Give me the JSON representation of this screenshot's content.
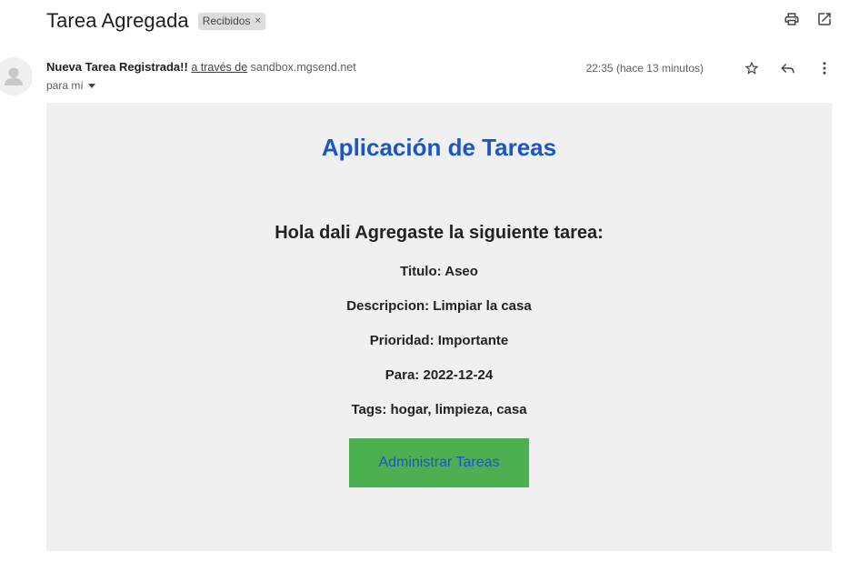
{
  "email": {
    "subject": "Tarea Agregada",
    "label": "Recibidos",
    "label_remove": "×",
    "sender_name": "Nueva Tarea Registrada!!",
    "via_text": "a través de",
    "via_domain": "sandbox.mgsend.net",
    "to_text": "para mí",
    "timestamp": "22:35 (hace 13 minutos)"
  },
  "icons": {
    "print": "print-icon",
    "open_new": "open-in-new-window-icon",
    "star": "star-icon",
    "reply": "reply-icon",
    "more": "more-vertical-icon",
    "avatar": "default-avatar-icon"
  },
  "body": {
    "title": "Aplicación de Tareas",
    "greeting": "Hola dali Agregaste la siguiente tarea:",
    "titulo": "Titulo: Aseo",
    "descripcion": "Descripcion: Limpiar la casa",
    "prioridad": "Prioridad: Importante",
    "para": "Para: 2022-12-24",
    "tags": "Tags: hogar, limpieza, casa",
    "button_label": "Administrar Tareas"
  },
  "colors": {
    "title_blue": "#1a56c8",
    "button_green": "#4caf50",
    "body_background": "#f0f0f0"
  }
}
